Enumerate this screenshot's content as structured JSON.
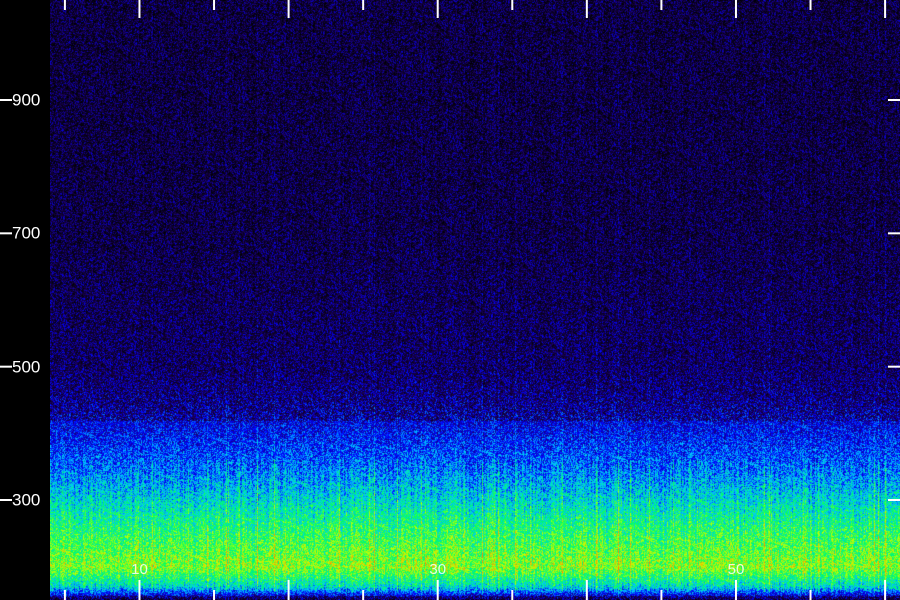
{
  "chart_data": {
    "type": "heatmap",
    "title": "",
    "xlabel": "",
    "ylabel": "",
    "x_tick_labels": [
      "10",
      "30",
      "50"
    ],
    "x_tick_values": [
      10,
      30,
      50
    ],
    "y_tick_labels": [
      "900",
      "700",
      "500",
      "300"
    ],
    "y_tick_values": [
      900,
      700,
      500,
      300
    ],
    "xlim": [
      4,
      61
    ],
    "ylim": [
      150,
      1050
    ],
    "colormap": [
      "#000000",
      "#1a0060",
      "#0000ff",
      "#00c8ff",
      "#00ff60",
      "#c8ff00",
      "#ff8000"
    ],
    "intensity_profile": [
      {
        "y": 150,
        "level": 0.15
      },
      {
        "y": 170,
        "level": 0.55
      },
      {
        "y": 200,
        "level": 0.78
      },
      {
        "y": 250,
        "level": 0.68
      },
      {
        "y": 300,
        "level": 0.55
      },
      {
        "y": 350,
        "level": 0.42
      },
      {
        "y": 400,
        "level": 0.33
      },
      {
        "y": 450,
        "level": 0.25
      },
      {
        "y": 500,
        "level": 0.2
      },
      {
        "y": 700,
        "level": 0.15
      },
      {
        "y": 900,
        "level": 0.14
      },
      {
        "y": 1050,
        "level": 0.14
      }
    ],
    "grid": false,
    "legend": "none"
  }
}
